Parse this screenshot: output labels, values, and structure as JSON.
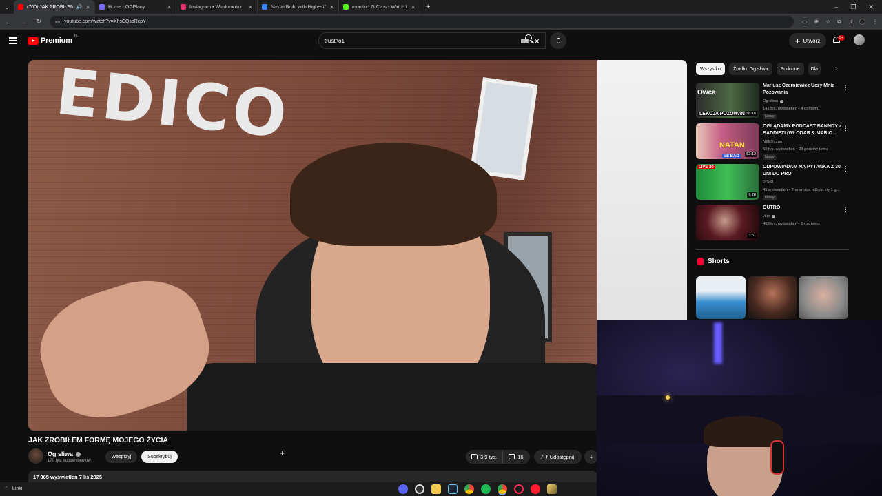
{
  "browser": {
    "tabs": [
      {
        "label": "(700) JAK ZROBIŁEM FORMĘ MOJEGO ŻYCIA",
        "active": true,
        "icon": "youtube-icon",
        "color": "#ff0000",
        "audio": true
      },
      {
        "label": "Home - OGPlany",
        "active": false,
        "icon": "ogplany-icon",
        "color": "#7b6cf6"
      },
      {
        "label": "Instagram • Wiadomości",
        "active": false,
        "icon": "instagram-icon",
        "color": "#e1306c"
      },
      {
        "label": "Nasfiri Build with Highest Win...",
        "active": false,
        "icon": "page-icon",
        "color": "#3b82f6"
      },
      {
        "label": "monitorLG Clips - Watch Live o...",
        "active": false,
        "icon": "kick-icon",
        "color": "#53fc18"
      }
    ],
    "url": "youtube.com/watch?v=XhsCQsbRcpY",
    "window_controls": [
      "–",
      "❐",
      "✕"
    ]
  },
  "header": {
    "logo_text": "Premium",
    "logo_region": "PL",
    "search_value": "trustno1",
    "create_label": "Utwórz",
    "notification_count": "9+"
  },
  "video": {
    "title": "JAK ZROBIŁEM FORMĘ MOJEGO ŻYCIA",
    "sign_text": "EDICO",
    "channel_name": "Og sliwa",
    "channel_subs": "170 tys. subskrybentów",
    "support_label": "Wesprzyj",
    "subscribe_label": "Subskrybuj",
    "likes": "3,9 tys.",
    "dislikes": "16",
    "share_label": "Udostępnij",
    "views_date": "17 365 wyświetleń  7 lis 2025"
  },
  "sidebar": {
    "chips": [
      "Wszystko",
      "Źródło: Og sliwa",
      "Podobne",
      "Dla..."
    ],
    "recommendations": [
      {
        "title": "Mariusz Czerniewicz Uczy Mnie Pozowania",
        "channel": "Og sliwa",
        "verified": true,
        "meta": "141 tys. wyświetleń • 4 dni temu",
        "badge": "Nowy",
        "duration": "56:16",
        "thumb_text": "Owca",
        "thumb_text2": "LEKCJA POZOWANIA",
        "thumb_bg": "#3a5a3a"
      },
      {
        "title": "OGLĄDAMY PODCAST BANNDY z BADDIEZI (WŁODAR & MARIO...",
        "channel": "NEEXcsgo",
        "verified": false,
        "meta": "60 tys. wyświetleń • 23 godziny temu",
        "badge": "Nowy",
        "duration": "52:12",
        "thumb_text": "NATAN",
        "thumb_text2": "VS BAD",
        "thumb_bg": "#b0436d"
      },
      {
        "title": "ODPOWIADAM NA PYTANKA Z 30 DNI DO PRO",
        "channel": "PiTeR",
        "verified": false,
        "meta": "45 wyświetleń • Transmisja odbyła się 1 g...",
        "badge": "Nowy",
        "duration": "7:28",
        "thumb_text": "LIVE 30",
        "thumb_text2": "",
        "thumb_bg": "#2f7d3a"
      },
      {
        "title": "OUTRO",
        "channel": "vkie",
        "verified": true,
        "meta": "468 tys. wyświetleń • 1 rok temu",
        "badge": "",
        "duration": "3:51",
        "thumb_text": "",
        "thumb_text2": "",
        "thumb_bg": "#2a0d12"
      }
    ],
    "shorts_label": "Shorts"
  },
  "taskbar": {
    "label": "Linki"
  }
}
